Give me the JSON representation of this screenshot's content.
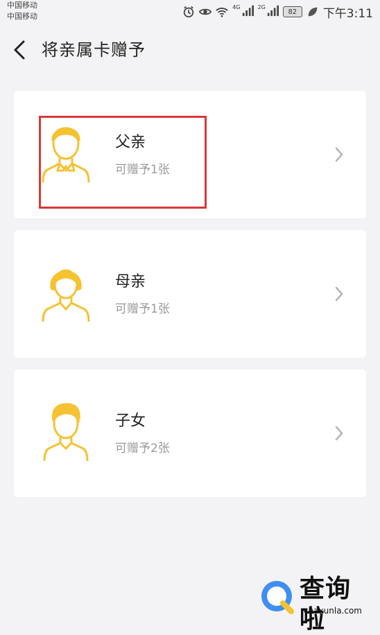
{
  "status_bar": {
    "carrier_1": "中国移动",
    "carrier_2": "中国移动",
    "net_1": "4G",
    "net_2": "2G",
    "battery": "82",
    "time": "下午3:11"
  },
  "header": {
    "back_icon": "chevron-left-icon",
    "title": "将亲属卡赠予"
  },
  "recipients": [
    {
      "name": "父亲",
      "subtitle": "可赠予1张",
      "icon": "father-avatar-icon",
      "highlighted": true
    },
    {
      "name": "母亲",
      "subtitle": "可赠予1张",
      "icon": "mother-avatar-icon",
      "highlighted": false
    },
    {
      "name": "子女",
      "subtitle": "可赠予2张",
      "icon": "child-avatar-icon",
      "highlighted": false
    }
  ],
  "watermark": {
    "text": "查询啦",
    "url": "chaxunla.com"
  },
  "colors": {
    "avatar": "#f5c232",
    "highlight_border": "#d93838",
    "background": "#f3f3f5"
  }
}
